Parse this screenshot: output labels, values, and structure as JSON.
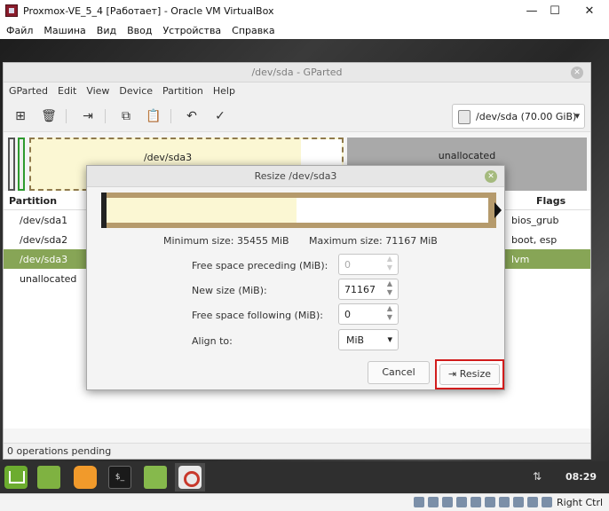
{
  "host": {
    "title": "Proxmox-VE_5_4 [Работает] - Oracle VM VirtualBox",
    "controls": [
      "—",
      "☐",
      "✕"
    ],
    "menu": [
      "Файл",
      "Машина",
      "Вид",
      "Ввод",
      "Устройства",
      "Справка"
    ],
    "status_right": "Right Ctrl"
  },
  "gparted": {
    "title": "/dev/sda - GParted",
    "menu": [
      "GParted",
      "Edit",
      "View",
      "Device",
      "Partition",
      "Help"
    ],
    "device": "/dev/sda  (70.00 GiB)",
    "graph": {
      "sda3": "/dev/sda3",
      "unallocated": "unallocated"
    },
    "table": {
      "col_partition": "Partition",
      "col_flags": "Flags",
      "rows": [
        {
          "name": "/dev/sda1",
          "flags": "bios_grub"
        },
        {
          "name": "/dev/sda2",
          "flags": "boot, esp"
        },
        {
          "name": "/dev/sda3",
          "flags": "lvm"
        },
        {
          "name": "unallocated",
          "flags": ""
        }
      ]
    },
    "status": "0 operations pending"
  },
  "dialog": {
    "title": "Resize /dev/sda3",
    "min_size": "Minimum size: 35455 MiB",
    "max_size": "Maximum size: 71167 MiB",
    "used_fraction": 0.498,
    "fields": {
      "free_preceding_label": "Free space preceding (MiB):",
      "free_preceding_value": "0",
      "new_size_label": "New size (MiB):",
      "new_size_value": "71167",
      "free_following_label": "Free space following (MiB):",
      "free_following_value": "0",
      "align_label": "Align to:",
      "align_value": "MiB"
    },
    "cancel_label": "Cancel",
    "resize_label": "Resize"
  },
  "taskbar": {
    "clock": "08:29"
  }
}
